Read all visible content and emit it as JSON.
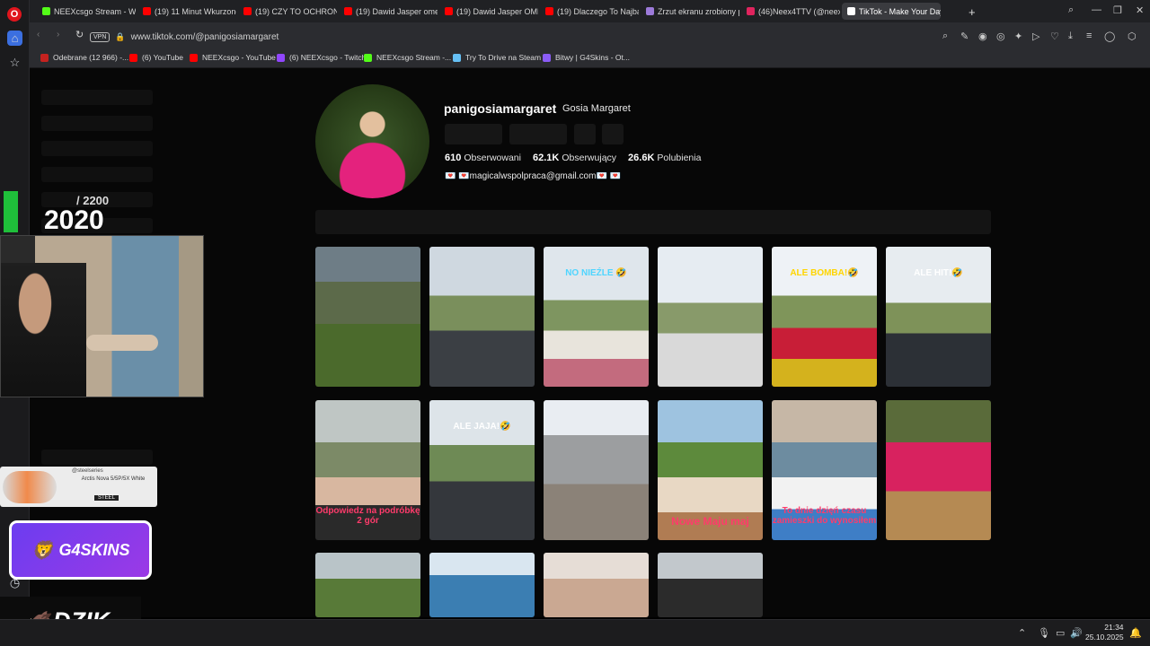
{
  "browser": {
    "tabs": [
      {
        "label": "NEEXcsgo Stream - Watch",
        "color": "#53fc18",
        "active": false
      },
      {
        "label": "(19) 11 Minut Wkurzonego",
        "color": "#ff0000",
        "active": false
      },
      {
        "label": "(19) CZY TO OCHRONI CI",
        "color": "#ff0000",
        "active": false
      },
      {
        "label": "(19) Dawid Jasper omegle",
        "color": "#ff0000",
        "active": false
      },
      {
        "label": "(19) Dawid Jasper OMEGL",
        "color": "#ff0000",
        "active": false
      },
      {
        "label": "(19) Dlaczego To Najbard",
        "color": "#ff0000",
        "active": false
      },
      {
        "label": "Zrzut ekranu zrobiony prz",
        "color": "#9c7ad9",
        "active": false
      },
      {
        "label": "(46)Neex4TTV (@neex4tt",
        "color": "#e0245e",
        "active": false
      },
      {
        "label": "TikTok - Make Your Day",
        "color": "#ffffff",
        "active": true
      }
    ],
    "url": "www.tiktok.com/@panigosiamargaret",
    "vpn_label": "VPN",
    "bookmarks": [
      {
        "label": "Odebrane (12 966) -...",
        "color": "#c5221f"
      },
      {
        "label": "(6) YouTube",
        "color": "#ff0000"
      },
      {
        "label": "NEEXcsgo - YouTube",
        "color": "#ff0000"
      },
      {
        "label": "(6) NEEXcsgo - Twitch",
        "color": "#9146ff"
      },
      {
        "label": "NEEXcsgo Stream -...",
        "color": "#53fc18"
      },
      {
        "label": "Try To Drive na Steam",
        "color": "#66c0f4"
      },
      {
        "label": "Bitwy | G4Skins - Ot...",
        "color": "#8b5cf6"
      }
    ]
  },
  "profile": {
    "username": "panigosiamargaret",
    "nickname": "Gosia Margaret",
    "stats": [
      {
        "value": "610",
        "label": "Obserwowani"
      },
      {
        "value": "62.1K",
        "label": "Obserwujący"
      },
      {
        "value": "26.6K",
        "label": "Polubienia"
      }
    ],
    "bio": "💌 💌magicalwspolpraca@gmail.com💌 💌"
  },
  "videos": [
    {
      "caption": "",
      "bg": "linear-gradient(#6e7d86 0 25%, #5c6a4a 25% 55%, #4b6a2c 55%)"
    },
    {
      "caption": "",
      "bg": "linear-gradient(#cfd8e0 0 35%, #7a8f5c 35% 60%, #3b3f44 60%)"
    },
    {
      "caption": "NO NIEŹLE 🤣",
      "bg": "linear-gradient(#dfe6ec 0 38%, #7e9560 38% 60%, #e8e4dc 60% 80%, #c36b7e 80%)"
    },
    {
      "caption": "",
      "bg": "linear-gradient(#e6ecf2 0 40%, #889a6a 40% 62%, #d9d9d9 62%)"
    },
    {
      "caption": "ALE BOMBA!🤣",
      "bg": "linear-gradient(#eef2f6 0 35%, #7f955a 35% 58%, #c81e37 58% 80%, #d4b21d 80%)"
    },
    {
      "caption": "ALE HIT!🤣",
      "bg": "linear-gradient(#e7ecf0 0 40%, #7e9259 40% 62%, #2c3036 62%)"
    },
    {
      "caption": "Odpowiedz na podróbkę 2 gór",
      "bg": "linear-gradient(#bfc6c4 0 30%, #7c8a67 30% 55%, #d8b7a0 55% 75%, #2a2a2a 75%)"
    },
    {
      "caption": "ALE JAJA!🤣",
      "bg": "linear-gradient(#dde4e9 0 32%, #6e8a55 32% 58%, #34373c 58%)"
    },
    {
      "caption": "",
      "bg": "linear-gradient(#e9edf2 0 25%, #9c9ea0 25% 60%, #8b8278 60%)"
    },
    {
      "caption": "Nowe Maju maj",
      "bg": "linear-gradient(#9ec3e0 0 30%, #5d8a3c 30% 55%, #e8d8c4 55% 80%, #b07c53 80%)"
    },
    {
      "caption": "To dnie dzięń czasu zamieszki do wynosiłem",
      "bg": "linear-gradient(#c6b7a6 0 30%, #6d8ca0 30% 55%, #f2f2f2 55% 78%, #3e7ec6 78%)"
    },
    {
      "caption": "",
      "bg": "linear-gradient(#5a6b3a 0 30%, #d8225f 30% 65%, #b58a53 65%)"
    },
    {
      "caption": "",
      "bg": "linear-gradient(#b9c4c8 0 40%, #587a38 40%)"
    },
    {
      "caption": "",
      "bg": "linear-gradient(#d9e6f0 0 35%, #3b7eb2 35%)"
    },
    {
      "caption": "",
      "bg": "linear-gradient(#e6ddd6 0 40%, #caa892 40%)"
    },
    {
      "caption": "",
      "bg": "linear-gradient(#c2c8cc 0 40%, #2b2b2b 40%)"
    }
  ],
  "overlay": {
    "counter_total": "/ 2200",
    "counter_year": "2020",
    "steel_brand": "@steelseries",
    "steel_product": "Arctis Nova 5/5P/5X White",
    "steel_tag": "STEEL",
    "g4skins": "G4SKINS",
    "dzik": "DZIK."
  },
  "taskbar": {
    "time": "21:34",
    "date": "25.10.2025"
  }
}
